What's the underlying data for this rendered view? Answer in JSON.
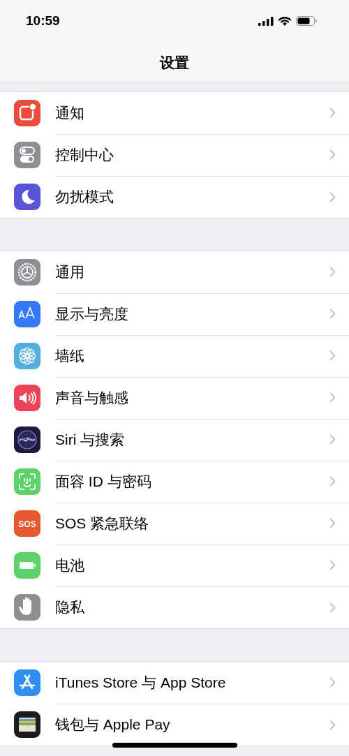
{
  "status_bar": {
    "time": "10:59"
  },
  "nav_bar": {
    "title": "设置"
  },
  "groups": [
    {
      "items": [
        {
          "label": "通知",
          "color": "#ea4c3e"
        },
        {
          "label": "控制中心",
          "color": "#8e8e93"
        },
        {
          "label": "勿扰模式",
          "color": "#5856d6"
        }
      ]
    },
    {
      "items": [
        {
          "label": "通用",
          "color": "#8e8e93"
        },
        {
          "label": "显示与亮度",
          "color": "#3478f6"
        },
        {
          "label": "墙纸",
          "color": "#55aee0"
        },
        {
          "label": "声音与触感",
          "color": "#ec4359"
        },
        {
          "label": "Siri 与搜索",
          "color": "#1c1c3c"
        },
        {
          "label": "面容 ID 与密码",
          "color": "#5fd16b"
        },
        {
          "label": "SOS 紧急联络",
          "color": "#e9582e",
          "icon_text": "SOS"
        },
        {
          "label": "电池",
          "color": "#5fd16b"
        },
        {
          "label": "隐私",
          "color": "#8e8e93"
        }
      ]
    },
    {
      "items": [
        {
          "label": "iTunes Store 与 App Store",
          "color": "#2f8ff4"
        },
        {
          "label": "钱包与 Apple Pay",
          "color": "#1c1c1e"
        }
      ]
    }
  ]
}
